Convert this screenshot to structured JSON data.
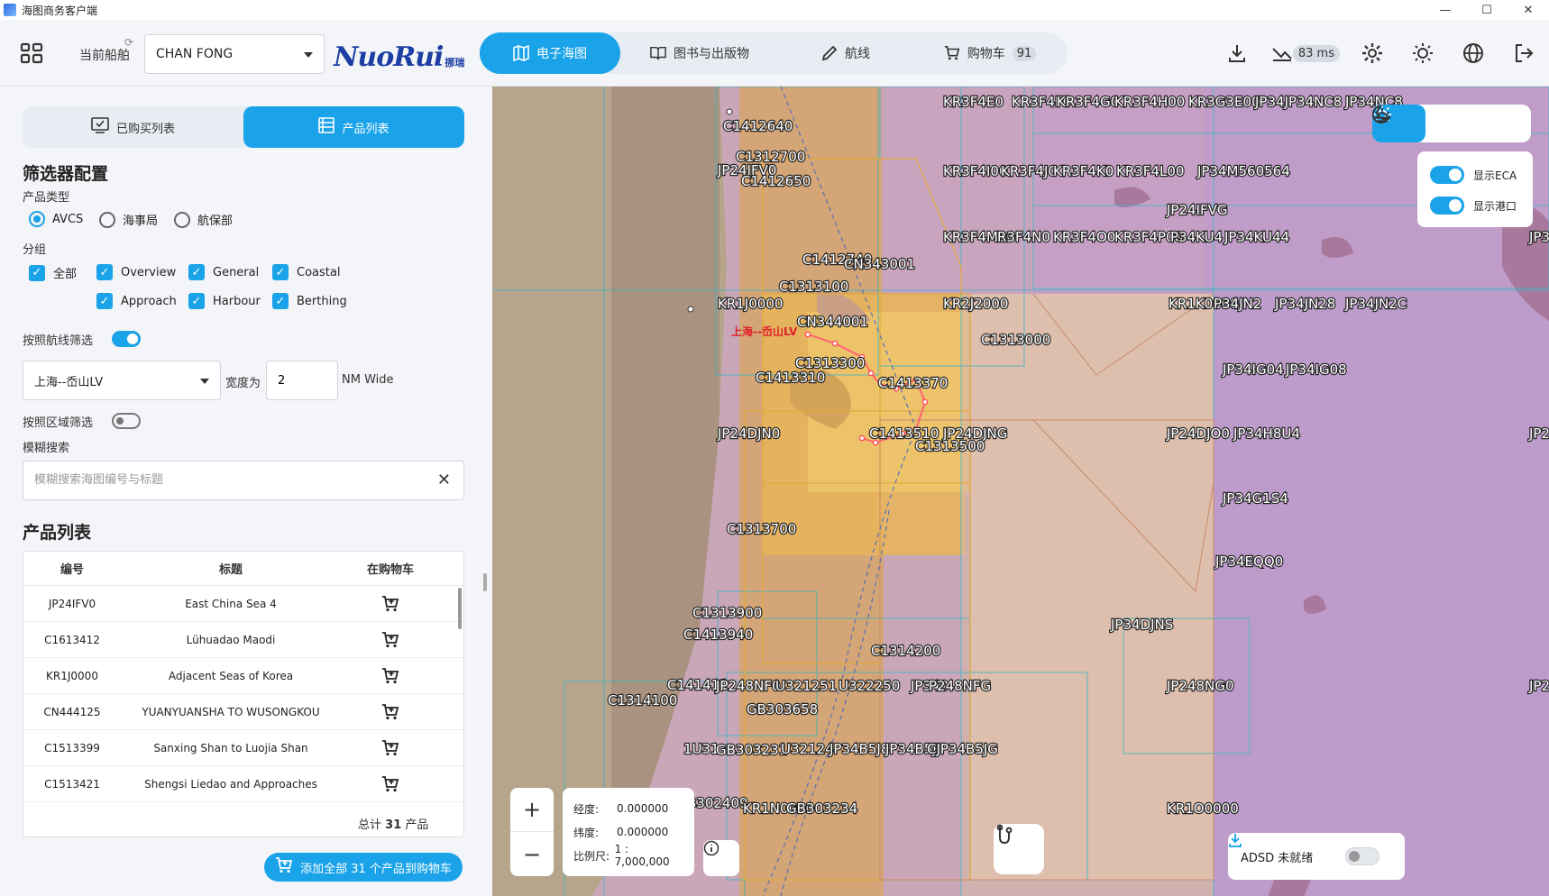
{
  "window": {
    "title": "海图商务客户端",
    "controls": [
      "—",
      "☐",
      "✕"
    ]
  },
  "header": {
    "ship_label": "当前船舶",
    "ship_value": "CHAN FONG",
    "brand": "NuoRui",
    "brand_cn": "挪瑞",
    "nav": [
      {
        "label": "电子海图",
        "icon": "map-icon",
        "active": true
      },
      {
        "label": "图书与出版物",
        "icon": "book-icon",
        "active": false
      },
      {
        "label": "航线",
        "icon": "pencil-icon",
        "active": false
      },
      {
        "label": "购物车",
        "icon": "cart-icon",
        "active": false,
        "badge": "91"
      }
    ],
    "latency": "83 ms"
  },
  "panel": {
    "tabs": [
      {
        "label": "已购买列表",
        "active": false
      },
      {
        "label": "产品列表",
        "active": true
      }
    ],
    "filter_title": "筛选器配置",
    "product_type_label": "产品类型",
    "product_types": [
      {
        "label": "AVCS",
        "selected": true
      },
      {
        "label": "海事局",
        "selected": false
      },
      {
        "label": "航保部",
        "selected": false
      }
    ],
    "group_label": "分组",
    "groups_row1": [
      "全部",
      "Overview",
      "General",
      "Coastal"
    ],
    "groups_row2": [
      "Approach",
      "Harbour",
      "Berthing"
    ],
    "route_filter_label": "按照航线筛选",
    "route_filter_on": true,
    "route_value": "上海--岙山LV",
    "width_label": "宽度为",
    "width_value": "2",
    "width_unit": "NM Wide",
    "area_filter_label": "按照区域筛选",
    "area_filter_on": false,
    "fuzzy_label": "模糊搜索",
    "search_placeholder": "模糊搜索海图编号与标题",
    "list_title": "产品列表",
    "columns": [
      "编号",
      "标题",
      "在购物车"
    ],
    "rows": [
      {
        "code": "JP24IFV0",
        "title": "East China Sea 4"
      },
      {
        "code": "C1613412",
        "title": "Lühuadao Maodi"
      },
      {
        "code": "KR1J0000",
        "title": "Adjacent Seas of Korea"
      },
      {
        "code": "CN444125",
        "title": "YUANYUANSHA TO WUSONGKOU"
      },
      {
        "code": "C1513399",
        "title": "Sanxing Shan to Luojia Shan"
      },
      {
        "code": "C1513421",
        "title": "Shengsi Liedao and Approaches"
      }
    ],
    "total_prefix": "总计",
    "total_count": "31",
    "total_suffix": "产品",
    "add_all_label": "添加全部 31 个产品到购物车"
  },
  "map": {
    "route_label": "上海--岙山LV",
    "layers": [
      {
        "label": "显示ECA",
        "on": true
      },
      {
        "label": "显示港口",
        "on": true
      }
    ],
    "lon_label": "经度:",
    "lon_value": "0.000000",
    "lat_label": "纬度:",
    "lat_value": "0.000000",
    "scale_label": "比例尺:",
    "scale_value": "1 : 7,000,000",
    "adsd_label": "ADSD 未就绪",
    "chart_labels": [
      "KR3F4E0",
      "KR3F4F0",
      "KR3F4G0",
      "KR3F4H00",
      "KR3G3E00",
      "JP34JP34NC8",
      "JP34NC8",
      "C1412640",
      "C1312700",
      "JP24IFV0",
      "C1412650",
      "KR3F4I00",
      "KR3F4J0",
      "KR3F4K0",
      "KR3F4L00",
      "JP34M560564",
      "JP24IFVG",
      "KR3F4M00",
      "R3F4N0",
      "KR3F4O0",
      "KR3F4P00",
      "P34KU4",
      "JP34KU44",
      "JP3",
      "C1412740",
      "CN343001",
      "C1313100",
      "KR1J0000",
      "KR2J2000",
      "KR1K0000",
      "P34JN2",
      "JP34JN28",
      "JP34JN2C",
      "CN344001",
      "C1313000",
      "C1313300",
      "C1413310",
      "C1413370",
      "JP34IG04",
      "JP34IG08",
      "JP24DJN0",
      "C1413510",
      "JP24DJNG",
      "C1313500",
      "JP24DJO0",
      "JP34H8U4",
      "JP2",
      "JP34G1S4",
      "C1313700",
      "JP34EQQ0",
      "JP34DJNS",
      "C1313900",
      "C1413940",
      "C1314200",
      "C141411",
      "JP248NF0",
      "U321251",
      "U322250",
      "JP340",
      "P248NFG",
      "JP248NG0",
      "JP2",
      "C1314100",
      "GB303658",
      "1U31",
      "GB303231",
      "U32124",
      "JP34B5J8",
      "JP34B5J",
      "CJP34B5JG",
      "B302409",
      "KR1N0000",
      "GB303234",
      "KR1O0000"
    ]
  }
}
